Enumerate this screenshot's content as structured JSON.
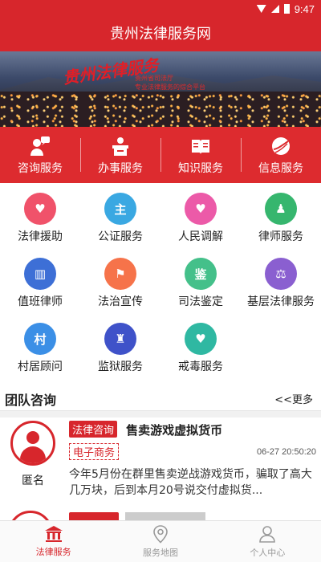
{
  "status_bar": {
    "time": "9:47"
  },
  "header": {
    "title": "贵州法律服务网"
  },
  "banner": {
    "logo_text": "贵州法律服务",
    "logo_sub": "",
    "tagline_line1": "贵州省司法厅",
    "tagline_line2": "专业法律服务的综合平台"
  },
  "main_tabs": [
    {
      "label": "咨询服务",
      "icon": "chat-user-icon"
    },
    {
      "label": "办事服务",
      "icon": "desk-icon"
    },
    {
      "label": "知识服务",
      "icon": "book-icon"
    },
    {
      "label": "信息服务",
      "icon": "globe-icon"
    }
  ],
  "services": [
    {
      "label": "法律援助",
      "icon": "heart-hands-icon",
      "color": "#f0526a",
      "glyph": "♥"
    },
    {
      "label": "公证服务",
      "icon": "notary-icon",
      "color": "#3aa8e2",
      "glyph": "主"
    },
    {
      "label": "人民调解",
      "icon": "handshake-icon",
      "color": "#ec5aa8",
      "glyph": "♥"
    },
    {
      "label": "律师服务",
      "icon": "lawyer-icon",
      "color": "#36b66e",
      "glyph": "♟"
    },
    {
      "label": "值班律师",
      "icon": "court-icon",
      "color": "#3d6fd6",
      "glyph": "▥"
    },
    {
      "label": "法治宣传",
      "icon": "flag-icon",
      "color": "#f6734a",
      "glyph": "⚑"
    },
    {
      "label": "司法鉴定",
      "icon": "appraisal-icon",
      "color": "#44c08a",
      "glyph": "鉴"
    },
    {
      "label": "基层法律服务",
      "icon": "scales-icon",
      "color": "#8a5fd0",
      "glyph": "⚖"
    },
    {
      "label": "村居顾问",
      "icon": "village-icon",
      "color": "#3b8fe6",
      "glyph": "村"
    },
    {
      "label": "监狱服务",
      "icon": "prison-icon",
      "color": "#3f52c9",
      "glyph": "♜"
    },
    {
      "label": "戒毒服务",
      "icon": "rehab-icon",
      "color": "#2fb8a2",
      "glyph": "♥"
    }
  ],
  "team": {
    "title": "团队咨询",
    "more": "<<更多",
    "case": {
      "user": "匿名",
      "category": "法律咨询",
      "title": "售卖游戏虚拟货币",
      "tag": "电子商务",
      "time": "06-27 20:50:20",
      "body": "今年5月份在群里售卖逆战游戏货币，骗取了高大几万块，后到本月20号说交付虚拟货..."
    }
  },
  "bottom_nav": [
    {
      "label": "法律服务",
      "icon": "courthouse-icon",
      "active": true
    },
    {
      "label": "服务地图",
      "icon": "map-pin-icon",
      "active": false
    },
    {
      "label": "个人中心",
      "icon": "person-icon",
      "active": false
    }
  ],
  "colors": {
    "brand_red": "#d7262c",
    "nav_active": "#d7262c",
    "nav_inactive": "#999999"
  }
}
